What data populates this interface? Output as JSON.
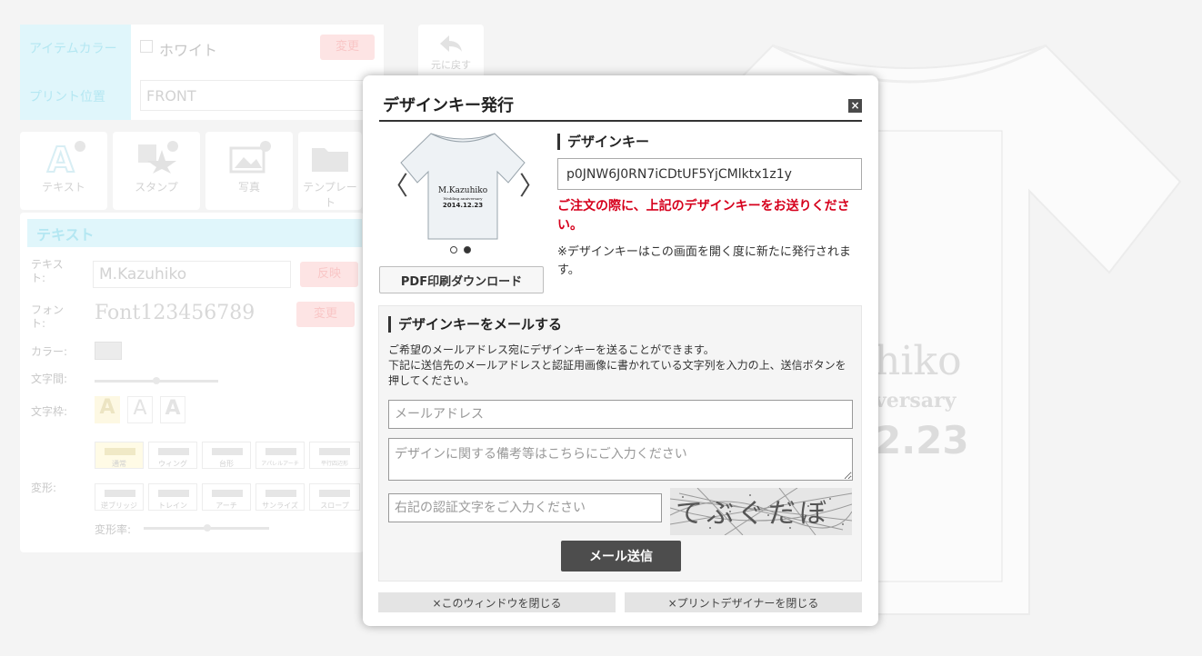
{
  "background": {
    "item_color_label": "アイテムカラー",
    "item_color_value": "ホワイト",
    "change_label": "変更",
    "print_position_label": "プリント位置",
    "print_position_value": "FRONT",
    "undo_label": "元に戻す",
    "tools": [
      "テキスト",
      "スタンプ",
      "写真",
      "テンプレート"
    ],
    "text_panel_title": "テキスト",
    "text_label": "テキスト:",
    "text_value": "M.Kazuhiko",
    "apply_label": "反映",
    "font_label": "フォント:",
    "font_value": "Font123456789",
    "color_label": "カラー:",
    "spacing_label": "文字間:",
    "outline_label": "文字枠:",
    "outline_glyph": "A",
    "deform_label": "変形:",
    "deform_rate_label": "変形率:",
    "shapes_row1": [
      "通常",
      "ウィング",
      "台形",
      "アパレルアーチ",
      "平行四辺形"
    ],
    "shapes_row2": [
      "逆ブリッジ",
      "トレイン",
      "アーチ",
      "サンライズ",
      "スロープ"
    ],
    "tee_line1": "hiko",
    "tee_line2": "versary",
    "tee_line3": "2.23"
  },
  "modal": {
    "title": "デザインキー発行",
    "close_glyph": "×",
    "preview": {
      "line1": "M.Kazuhiko",
      "line2": "Wedding anniversary",
      "line3": "2014.12.23",
      "prev_glyph": "〈",
      "next_glyph": "〉"
    },
    "pdf_button": "PDF印刷ダウンロード",
    "key_heading": "デザインキー",
    "key_value": "p0JNW6J0RN7iCDtUF5YjCMlktx1z1y",
    "key_warning": "ご注文の際に、上記のデザインキーをお送りください。",
    "key_note": "※デザインキーはこの画面を開く度に新たに発行されます。",
    "mail": {
      "heading": "デザインキーをメールする",
      "desc1": "ご希望のメールアドレス宛にデザインキーを送ることができます。",
      "desc2": "下記に送信先のメールアドレスと認証用画像に書かれている文字列を入力の上、送信ボタンを押してください。",
      "email_placeholder": "メールアドレス",
      "note_placeholder": "デザインに関する備考等はこちらにご入力ください",
      "captcha_placeholder": "右記の認証文字をご入力ください",
      "captcha_text": "てぶぐだぼ",
      "send_button": "メール送信"
    },
    "close_window_button": "×このウィンドウを閉じる",
    "close_designer_button": "×プリントデザイナーを閉じる"
  }
}
